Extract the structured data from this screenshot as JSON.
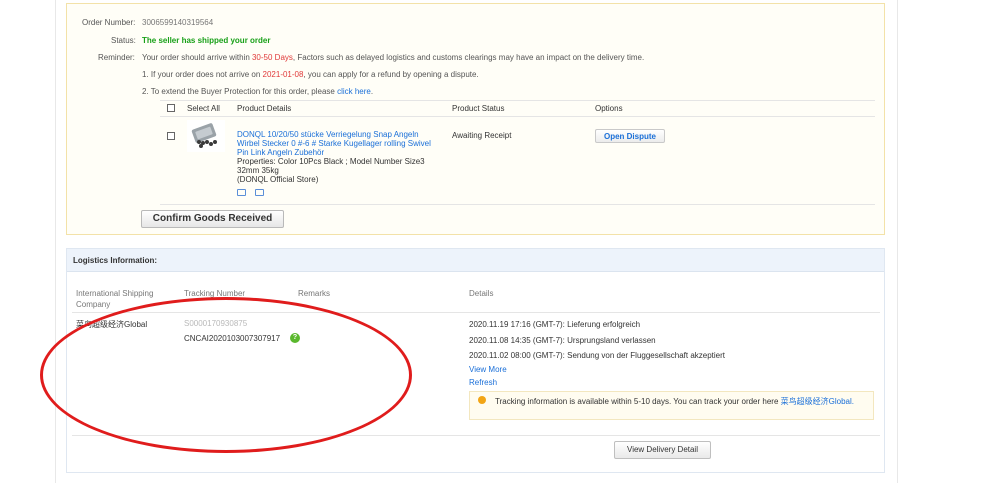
{
  "order": {
    "number_label": "Order Number:",
    "number_value": "3006599140319564",
    "status_label": "Status:",
    "status_value": "The seller has shipped your order",
    "reminder_label": "Reminder:",
    "reminder_pre": "Your order should arrive within ",
    "reminder_days": "30-50 Days",
    "reminder_post": ", Factors such as delayed logistics and customs clearings may have an impact on the delivery time.",
    "line1_pre": "1. If your order does not arrive on ",
    "line1_date": "2021-01-08",
    "line1_post": ", you can apply for a refund by opening a dispute.",
    "line2_pre": "2. To extend the Buyer Protection for this order, please ",
    "line2_link": "click here",
    "line2_post": "."
  },
  "products": {
    "headers": {
      "select_all": "Select All",
      "details": "Product Details",
      "status": "Product Status",
      "options": "Options"
    },
    "item": {
      "name": "DONQL 10/20/50 stücke Verriegelung Snap Angeln Wirbel Stecker 0 #-6 # Starke Kugellager rolling Swivel Pin Link Angeln Zubehör",
      "properties": "Properties: Color 10Pcs Black ; Model Number Size3 32mm 35kg",
      "store": "(DONQL Official Store)",
      "status": "Awaiting Receipt",
      "dispute_button": "Open Dispute"
    },
    "confirm_button": "Confirm Goods Received"
  },
  "logistics": {
    "title": "Logistics Information:",
    "headers": {
      "company": "International Shipping Company",
      "tracking": "Tracking Number",
      "remarks": "Remarks",
      "details": "Details"
    },
    "company": "菜鸟超级经济Global",
    "tracking_old": "S0000170930875",
    "tracking_new": "CNCAI2020103007307917",
    "events": [
      "2020.11.19 17:16 (GMT-7): Lieferung erfolgreich",
      "2020.11.08 14:35 (GMT-7): Ursprungsland verlassen",
      "2020.11.02 08:00 (GMT-7): Sendung von der Fluggesellschaft akzeptiert"
    ],
    "view_more": "View More",
    "refresh": "Refresh",
    "tip_pre": "Tracking information is available within 5-10 days. You can track your order here ",
    "tip_link": "菜鸟超级经济Global.",
    "delivery_button": "View Delivery Detail"
  },
  "colors": {
    "annotation": "#e01c1c",
    "link": "#1a6fd8",
    "shipped": "#18a018"
  }
}
